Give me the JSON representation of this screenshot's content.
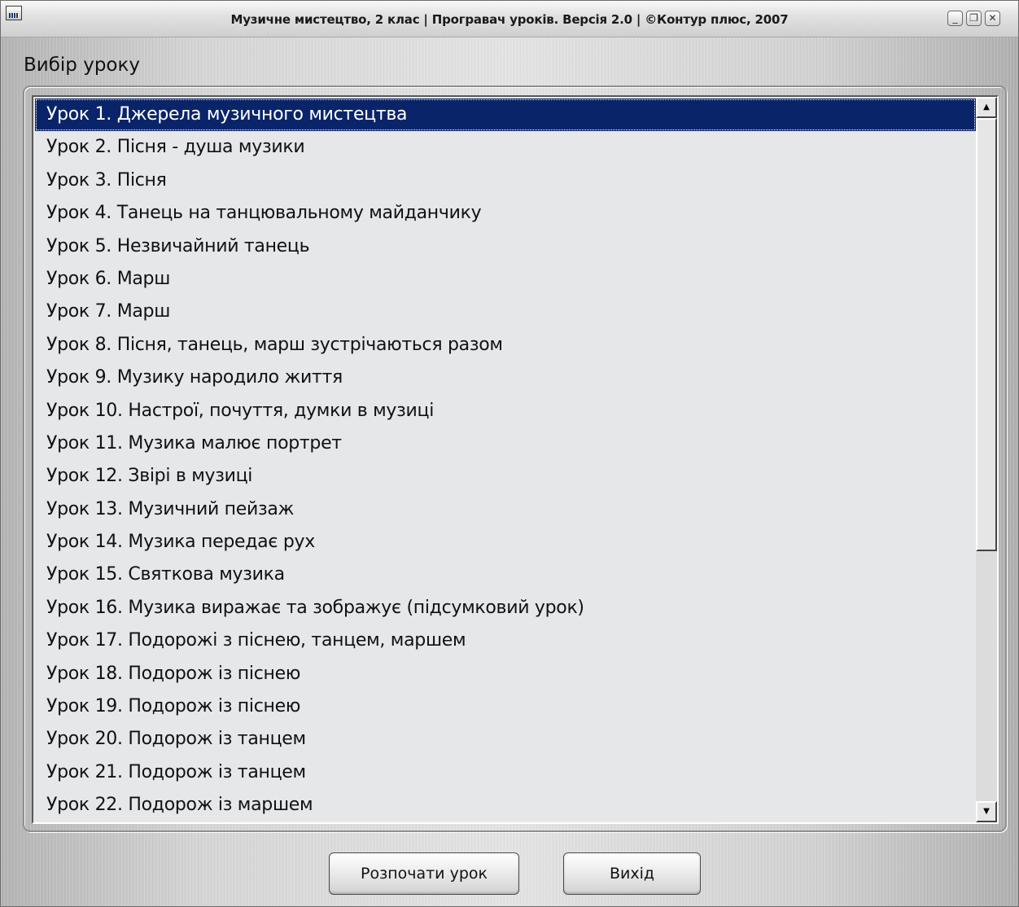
{
  "window": {
    "title": "Музичне мистецтво, 2 клас | Програвач уроків. Версія 2.0 | ©Контур плюс, 2007",
    "icon": "app-icon",
    "controls": {
      "minimize": "_",
      "restore": "❐",
      "close": "✕"
    }
  },
  "main": {
    "heading": "Вибір уроку",
    "lessons": [
      {
        "label": "Урок 1. Джерела музичного мистецтва",
        "selected": true
      },
      {
        "label": "Урок 2. Пісня - душа музики"
      },
      {
        "label": "Урок 3. Пісня"
      },
      {
        "label": "Урок 4. Танець на танцювальному майданчику"
      },
      {
        "label": "Урок 5. Незвичайний танець"
      },
      {
        "label": "Урок 6. Марш"
      },
      {
        "label": "Урок 7. Марш"
      },
      {
        "label": "Урок 8. Пісня, танець, марш зустрічаються разом"
      },
      {
        "label": "Урок 9. Музику народило життя"
      },
      {
        "label": "Урок 10. Настрої, почуття, думки в музиці"
      },
      {
        "label": "Урок 11. Музика малює портрет"
      },
      {
        "label": "Урок 12. Звірі в музиці"
      },
      {
        "label": "Урок 13. Музичний пейзаж"
      },
      {
        "label": "Урок 14. Музика передає рух"
      },
      {
        "label": "Урок 15. Святкова музика"
      },
      {
        "label": "Урок 16. Музика виражає та зображує (підсумковий урок)"
      },
      {
        "label": "Урок 17. Подорожі з піснею, танцем, маршем"
      },
      {
        "label": "Урок 18. Подорож із піснею"
      },
      {
        "label": "Урок 19. Подорож із піснею"
      },
      {
        "label": "Урок 20. Подорож із танцем"
      },
      {
        "label": "Урок 21. Подорож із танцем"
      },
      {
        "label": "Урок 22. Подорож із маршем"
      }
    ],
    "scroll": {
      "up_icon": "▲",
      "down_icon": "▼",
      "position": 0
    }
  },
  "footer": {
    "start_label": "Розпочати урок",
    "exit_label": "Вихід"
  },
  "colors": {
    "selection": "#0a2469",
    "list_background": "#e5e7e8"
  }
}
